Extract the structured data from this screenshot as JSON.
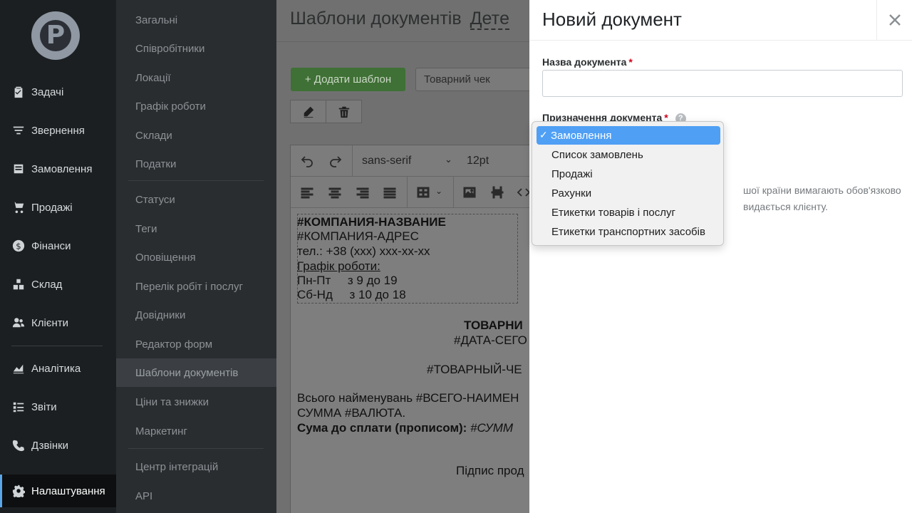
{
  "sidebar": {
    "items": [
      {
        "label": "Задачі",
        "icon": "clipboard-icon"
      },
      {
        "label": "Звернення",
        "icon": "filter-icon"
      },
      {
        "label": "Замовлення",
        "icon": "order-icon"
      },
      {
        "label": "Продажі",
        "icon": "cart-icon"
      },
      {
        "label": "Фінанси",
        "icon": "dollar-icon"
      },
      {
        "label": "Склад",
        "icon": "boxes-icon"
      },
      {
        "label": "Клієнти",
        "icon": "users-icon"
      },
      {
        "label": "Аналітика",
        "icon": "chart-icon"
      },
      {
        "label": "Звіти",
        "icon": "list-icon"
      },
      {
        "label": "Дзвінки",
        "icon": "phone-icon"
      },
      {
        "label": "Налаштування",
        "icon": "gear-icon"
      }
    ]
  },
  "submenu": {
    "items": [
      "Загальні",
      "Співробітники",
      "Локації",
      "Графік роботи",
      "Склади",
      "Податки",
      "Статуси",
      "Теги",
      "Оповіщення",
      "Перелік робіт і послуг",
      "Довідники",
      "Редактор форм",
      "Шаблони документів",
      "Ціни та знижки",
      "Маркетинг",
      "Центр інтеграцій",
      "API"
    ]
  },
  "content": {
    "title": "Шаблони документів",
    "title_link": "Детe",
    "add_button": "+ Додати шаблон",
    "template_select": "Товарний чек",
    "font_family": "sans-serif",
    "font_size": "12pt",
    "doc": {
      "company_name": "#КОМПАНИЯ-НАЗВАНИЕ",
      "company_address": "#КОМПАНИЯ-АДРЕС",
      "phone": "тел.: +38 (xxx) xxx-xx-xx",
      "schedule_title": "Графік роботи:",
      "schedule_weekdays": "Пн-Пт     з 9 до 19",
      "schedule_weekend": "Сб-Нд     з 10 до 18",
      "receipt_title": "ТОВАРНИ",
      "date_var": "#ДАТА-СЕГО",
      "receipt_var": "#ТОВАРНЫЙ-ЧЕ",
      "total_items": "Всього найменувань #ВСЕГО-НАИМЕН",
      "sum_currency": "СУММА #ВАЛЮТА.",
      "sum_words_label": "Сума до сплати (прописом):",
      "sum_words_var": " #СУММ",
      "signature": "Підпис прод"
    }
  },
  "panel": {
    "title": "Новий документ",
    "name_label": "Назва документа",
    "name_value": "",
    "purpose_label": "Призначення документа",
    "required_mark": "*",
    "help_mark": "?",
    "hint_line1": "шої країни вимагають обов'язково",
    "hint_line2": "видається клієнту."
  },
  "dropdown": {
    "selected": "Замовлення",
    "check": "✓",
    "options": [
      "Замовлення",
      "Список замовлень",
      "Продажі",
      "Рахунки",
      "Етикетки товарів і послуг",
      "Етикетки транспортних засобів"
    ]
  },
  "colors": {
    "accent": "#5aa6e8",
    "dropdown_selected": "#4f9ff5",
    "required": "#d0021b",
    "add_button": "#4caf50"
  }
}
